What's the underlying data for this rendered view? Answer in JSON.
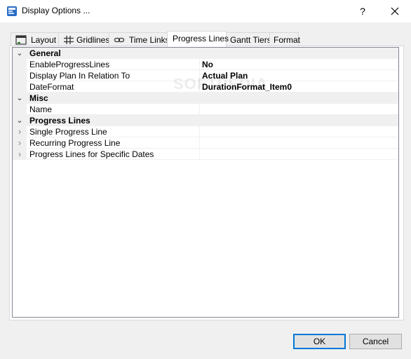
{
  "window": {
    "title": "Display Options ...",
    "help_label": "?",
    "close_label": "✕"
  },
  "tabs": [
    {
      "label": "Layout",
      "icon": "layout-icon",
      "active": false
    },
    {
      "label": "Gridlines",
      "icon": "gridlines-icon",
      "active": false
    },
    {
      "label": "Time Links",
      "icon": "link-icon",
      "active": false
    },
    {
      "label": "Progress Lines",
      "icon": "",
      "active": true
    },
    {
      "label": "Gantt Tiers",
      "icon": "",
      "active": false
    },
    {
      "label": "Format",
      "icon": "",
      "active": false
    }
  ],
  "grid": {
    "categories": {
      "general": "General",
      "misc": "Misc",
      "progress_lines": "Progress Lines"
    },
    "general_items": [
      {
        "name": "EnableProgressLines",
        "value": "No"
      },
      {
        "name": "Display Plan In Relation To",
        "value": "Actual Plan"
      },
      {
        "name": "DateFormat",
        "value": "DurationFormat_Item0"
      }
    ],
    "misc_items": [
      {
        "name": "Name",
        "value": ""
      }
    ],
    "progress_items": [
      {
        "name": "Single Progress Line"
      },
      {
        "name": "Recurring Progress Line"
      },
      {
        "name": "Progress Lines for Specific Dates"
      }
    ],
    "expanded_glyph": "⌄",
    "collapsed_glyph": "›"
  },
  "buttons": {
    "ok": "OK",
    "cancel": "Cancel"
  },
  "watermark": "SOFTPEDIA",
  "colors": {
    "accent": "#0078d7",
    "tab_border": "#d9d9d9",
    "grid_border": "#828790"
  }
}
